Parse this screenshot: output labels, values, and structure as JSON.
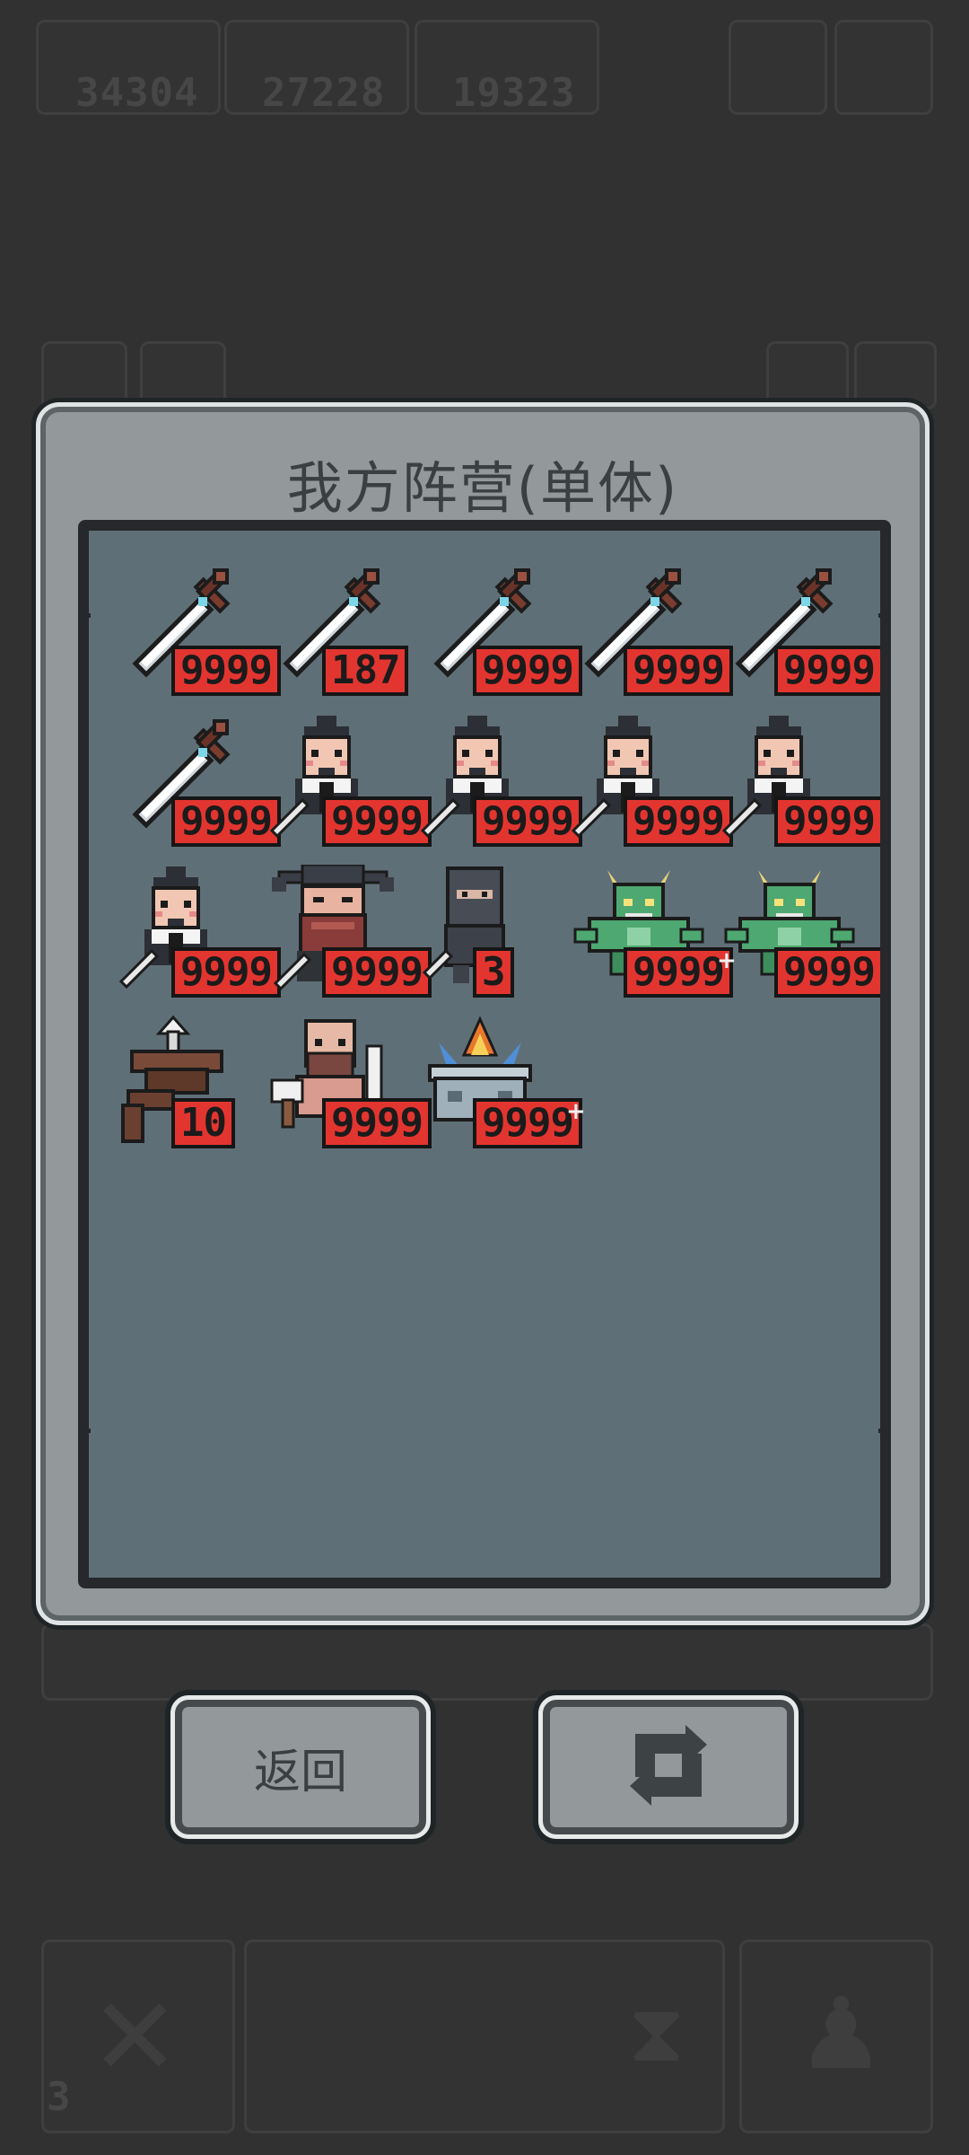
{
  "background": {
    "top_counters": [
      "34304",
      "27228",
      "19323"
    ],
    "bottom_counter": "3"
  },
  "dialog": {
    "title": "我方阵营(单体)",
    "units": [
      {
        "type": "sword",
        "count": "9999",
        "icon": "sword-icon"
      },
      {
        "type": "sword",
        "count": "187",
        "icon": "sword-icon"
      },
      {
        "type": "sword",
        "count": "9999",
        "icon": "sword-icon"
      },
      {
        "type": "sword",
        "count": "9999",
        "icon": "sword-icon"
      },
      {
        "type": "sword",
        "count": "9999",
        "icon": "sword-icon"
      },
      {
        "type": "sword",
        "count": "9999",
        "icon": "sword-icon"
      },
      {
        "type": "soldier",
        "count": "9999",
        "icon": "soldier-icon"
      },
      {
        "type": "soldier",
        "count": "9999",
        "icon": "soldier-icon"
      },
      {
        "type": "soldier",
        "count": "9999",
        "icon": "soldier-icon"
      },
      {
        "type": "soldier",
        "count": "9999",
        "icon": "soldier-icon"
      },
      {
        "type": "soldier",
        "count": "9999",
        "icon": "soldier-icon"
      },
      {
        "type": "general",
        "count": "9999",
        "icon": "bearded-general-icon"
      },
      {
        "type": "ninja",
        "count": "3",
        "icon": "ninja-icon"
      },
      {
        "type": "dragon",
        "count": "9999",
        "icon": "green-dragon-icon",
        "plus": "+"
      },
      {
        "type": "dragon",
        "count": "9999",
        "icon": "green-dragon-icon"
      },
      {
        "type": "ballista",
        "count": "10",
        "icon": "ballista-icon"
      },
      {
        "type": "monk",
        "count": "9999",
        "icon": "monk-warrior-icon"
      },
      {
        "type": "altar",
        "count": "9999",
        "icon": "fire-altar-icon",
        "plus": "+"
      }
    ]
  },
  "buttons": {
    "back_label": "返回",
    "refresh_icon": "refresh-icon"
  },
  "colors": {
    "count_badge": "#e33530",
    "panel": "#93999a",
    "inner": "#5f6f77"
  }
}
